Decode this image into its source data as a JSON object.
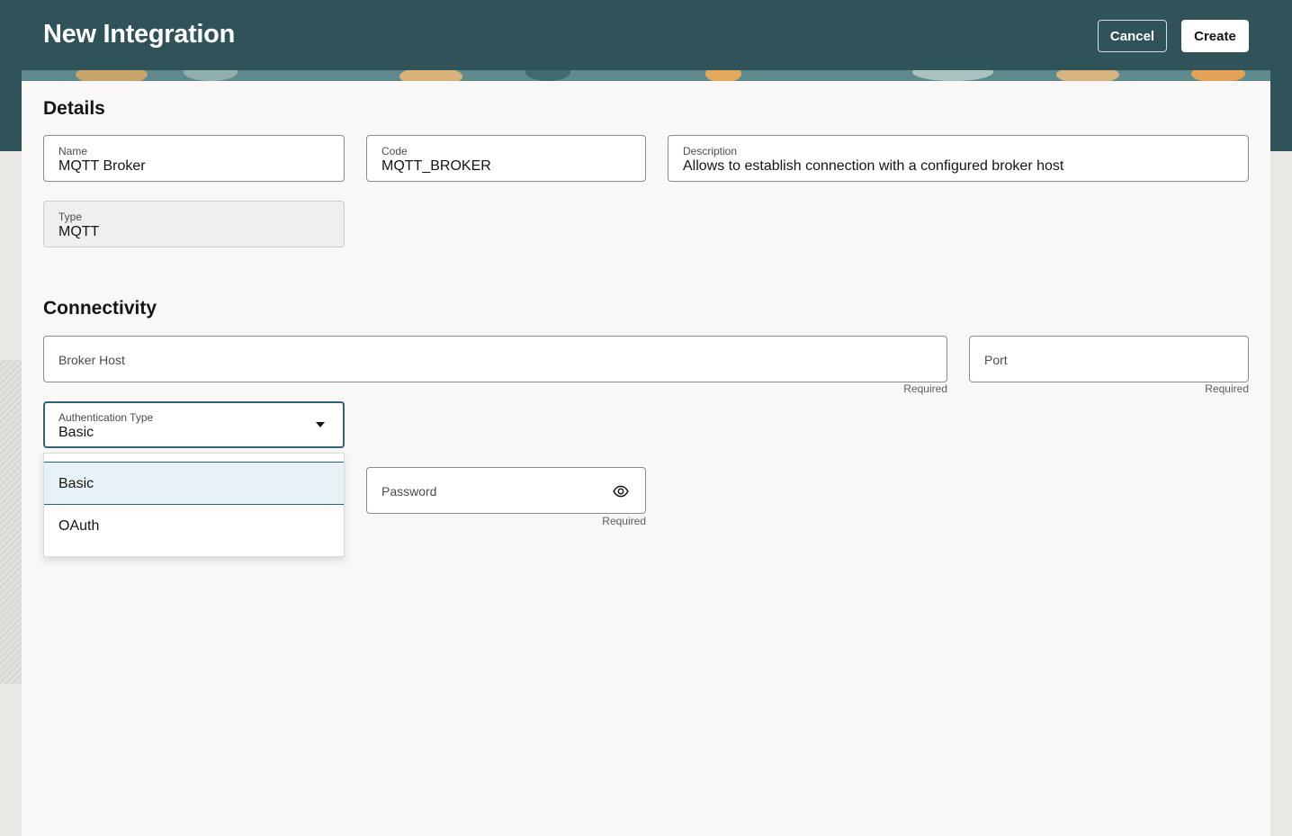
{
  "header": {
    "title": "New Integration",
    "cancel_label": "Cancel",
    "create_label": "Create"
  },
  "details": {
    "section_title": "Details",
    "name": {
      "label": "Name",
      "value": "MQTT Broker"
    },
    "code": {
      "label": "Code",
      "value": "MQTT_BROKER"
    },
    "description": {
      "label": "Description",
      "value": "Allows to establish connection with a configured broker host"
    },
    "type": {
      "label": "Type",
      "value": "MQTT"
    }
  },
  "connectivity": {
    "section_title": "Connectivity",
    "broker_host": {
      "placeholder": "Broker Host",
      "helper": "Required"
    },
    "port": {
      "placeholder": "Port",
      "helper": "Required"
    },
    "auth_type": {
      "label": "Authentication Type",
      "value": "Basic",
      "options": [
        "Basic",
        "OAuth"
      ],
      "selected_index": 0
    },
    "password": {
      "placeholder": "Password",
      "helper": "Required"
    }
  },
  "colors": {
    "header_bg": "#30535a",
    "accent": "#2c6572",
    "panel_bg": "#f9f8f6",
    "selected_option_bg": "#e7f2f7"
  },
  "icons": {
    "auth_dropdown": "caret-down-icon",
    "password_toggle": "eye-icon"
  }
}
